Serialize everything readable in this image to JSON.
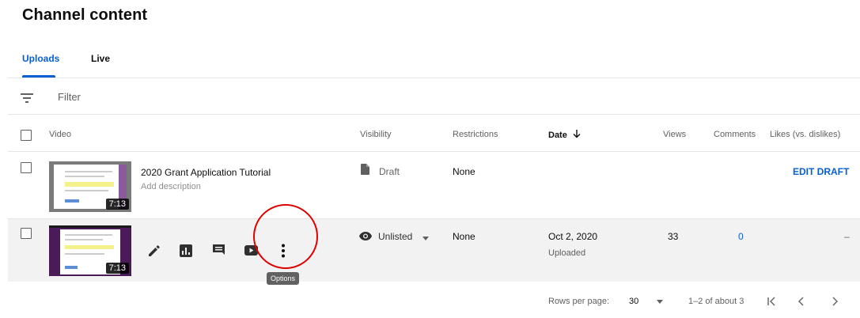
{
  "page": {
    "title": "Channel content"
  },
  "tabs": [
    {
      "label": "Uploads",
      "active": true
    },
    {
      "label": "Live",
      "active": false
    }
  ],
  "filter": {
    "placeholder": "Filter",
    "icon": "filter-icon"
  },
  "columns": {
    "video": "Video",
    "visibility": "Visibility",
    "restrictions": "Restrictions",
    "date": "Date",
    "views": "Views",
    "comments": "Comments",
    "likes": "Likes (vs. dislikes)"
  },
  "rows": [
    {
      "title": "2020 Grant Application Tutorial",
      "description": "Add description",
      "duration": "7:13",
      "visibility": "Draft",
      "visibility_icon": "draft-icon",
      "restrictions": "None",
      "action": "EDIT DRAFT"
    },
    {
      "duration": "7:13",
      "visibility": "Unlisted",
      "visibility_icon": "eye-icon",
      "restrictions": "None",
      "date": "Oct 2, 2020",
      "date_status": "Uploaded",
      "views": "33",
      "comments": "0",
      "likes": "–",
      "actions": [
        "pencil-icon",
        "analytics-icon",
        "comments-icon",
        "youtube-icon",
        "options-icon"
      ],
      "tooltip": "Options"
    }
  ],
  "pagination": {
    "rows_per_page_label": "Rows per page:",
    "rows_per_page": "30",
    "range": "1–2 of about 3"
  },
  "colors": {
    "accent": "#065fd4",
    "annotation": "#e00000"
  }
}
